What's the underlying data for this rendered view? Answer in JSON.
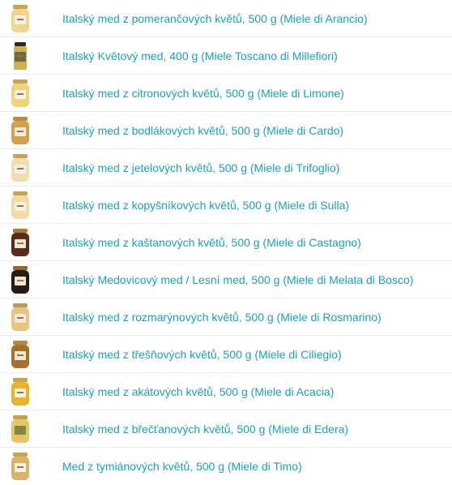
{
  "products": [
    {
      "name": "Italský med z pomerančových květů, 500 g (Miele di Arancio)",
      "lid": "#c9a254",
      "honey": "#f1d58c",
      "tag": "#f6f1e2",
      "style": "round"
    },
    {
      "name": "Italský Květový med, 400 g (Miele Toscano di Millefiori)",
      "lid": "#2c2a1e",
      "honey": "#d2b052",
      "tag": "#6f6a3b",
      "style": "tall"
    },
    {
      "name": "Italský med z citronových květů, 500 g (Miele di Limone)",
      "lid": "#c9a254",
      "honey": "#f0d47d",
      "tag": "#f6f1e2",
      "style": "round"
    },
    {
      "name": "Italský med z bodlákových květů, 500 g (Miele di Cardo)",
      "lid": "#b98d3f",
      "honey": "#cfa24f",
      "tag": "#f2ead2",
      "style": "round"
    },
    {
      "name": "Italský med z jetelových květů, 500 g (Miele di Trifoglio)",
      "lid": "#c9a254",
      "honey": "#f1ddb0",
      "tag": "#f6f1e2",
      "style": "round"
    },
    {
      "name": "Italský med z kopyšníkových květů, 500 g (Miele di Sulla)",
      "lid": "#c9a254",
      "honey": "#f0dca4",
      "tag": "#f6f1e2",
      "style": "round"
    },
    {
      "name": "Italský med z kaštanových květů, 500 g (Miele di Castagno)",
      "lid": "#a17c3a",
      "honey": "#5a2a1c",
      "tag": "#efe6cf",
      "style": "round"
    },
    {
      "name": "Italský Medovicový med / Lesní med, 500 g (Miele di Melata di Bosco)",
      "lid": "#8e6d35",
      "honey": "#2a1a16",
      "tag": "#efe6cf",
      "style": "round"
    },
    {
      "name": "Italský med z rozmarýnových květů, 500 g (Miele di Rosmarino)",
      "lid": "#c0995a",
      "honey": "#e5c57f",
      "tag": "#f4ecd8",
      "style": "round"
    },
    {
      "name": "Italský med z třešňových květů, 500 g (Miele di Ciliegio)",
      "lid": "#b48a44",
      "honey": "#a5722e",
      "tag": "#efe6cf",
      "style": "round"
    },
    {
      "name": "Italský med z akátových květů, 500 g (Miele di Acacia)",
      "lid": "#c9a254",
      "honey": "#e7b52a",
      "tag": "#f6f1e2",
      "style": "round"
    },
    {
      "name": "Italský med z břečťanových květů, 500 g (Miele di Edera)",
      "lid": "#c7a04b",
      "honey": "#e8c46a",
      "tag": "#7f8b3a",
      "style": "round"
    },
    {
      "name": "Med z tymiánových květů, 500 g (Miele di Timo)",
      "lid": "#c9a254",
      "honey": "#d8b46b",
      "tag": "#f6f1e2",
      "style": "round"
    }
  ]
}
